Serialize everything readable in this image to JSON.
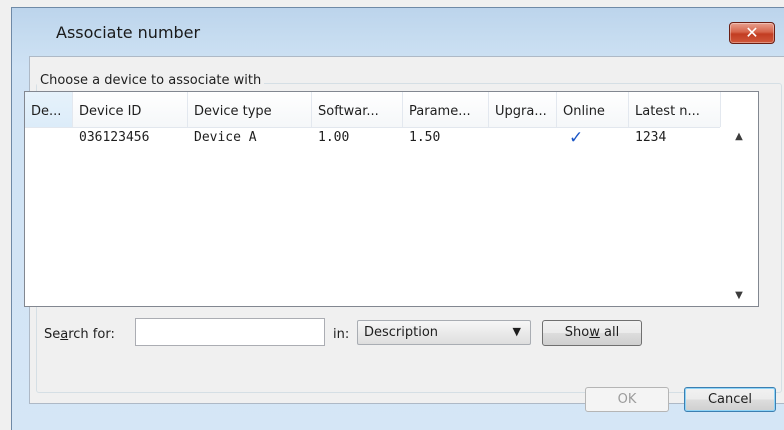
{
  "window": {
    "title": "Associate number",
    "close_glyph": "✕"
  },
  "group": {
    "legend": "Choose a device to associate with"
  },
  "table": {
    "columns": [
      "De...",
      "Device ID",
      "Device type",
      "Softwar...",
      "Parame...",
      "Upgra...",
      "Online",
      "Latest n..."
    ],
    "sorted_column_index": 0,
    "sort_direction": "ascending",
    "rows": [
      {
        "description": "",
        "device_id": "036123456",
        "device_type": "Device A",
        "software": "1.00",
        "parameters": "1.50",
        "upgrade": "",
        "online": "✓",
        "latest_n": "1234"
      }
    ]
  },
  "search": {
    "label_pre": "Se",
    "label_accel": "a",
    "label_post": "rch for:",
    "value": "",
    "in_label": "in:",
    "field_selected": "Description",
    "show_all_pre": "Sho",
    "show_all_accel": "w",
    "show_all_post": " all"
  },
  "buttons": {
    "ok": "OK",
    "cancel": "Cancel"
  },
  "icons": {
    "scroll_up": "▲",
    "scroll_down": "▼",
    "dropdown": "▼",
    "sort_up": "︿"
  },
  "colors": {
    "check_blue": "#1b56c6",
    "close_red": "#c23d22"
  }
}
